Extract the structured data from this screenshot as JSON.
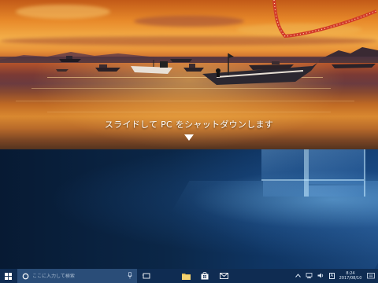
{
  "shutdown_panel": {
    "slide_text": "スライドして PC をシャットダウンします"
  },
  "taskbar": {
    "search_placeholder": "ここに入力して検索",
    "clock_time": "8:24",
    "clock_date": "2017/08/10"
  },
  "icons": {
    "start": "windows-logo-icon",
    "cortana": "cortana-circle-icon",
    "microphone": "microphone-icon",
    "task_view": "task-view-icon",
    "file_explorer": "folder-icon",
    "store": "store-bag-icon",
    "mail": "mail-icon",
    "show_hidden": "chevron-up-icon",
    "network": "network-icon",
    "volume": "speaker-icon",
    "ime": "ime-icon",
    "notifications": "action-center-icon"
  },
  "colors": {
    "taskbar": "#0f2c52",
    "search_box": "#2a4d78",
    "accent": "#1e6bd6"
  }
}
